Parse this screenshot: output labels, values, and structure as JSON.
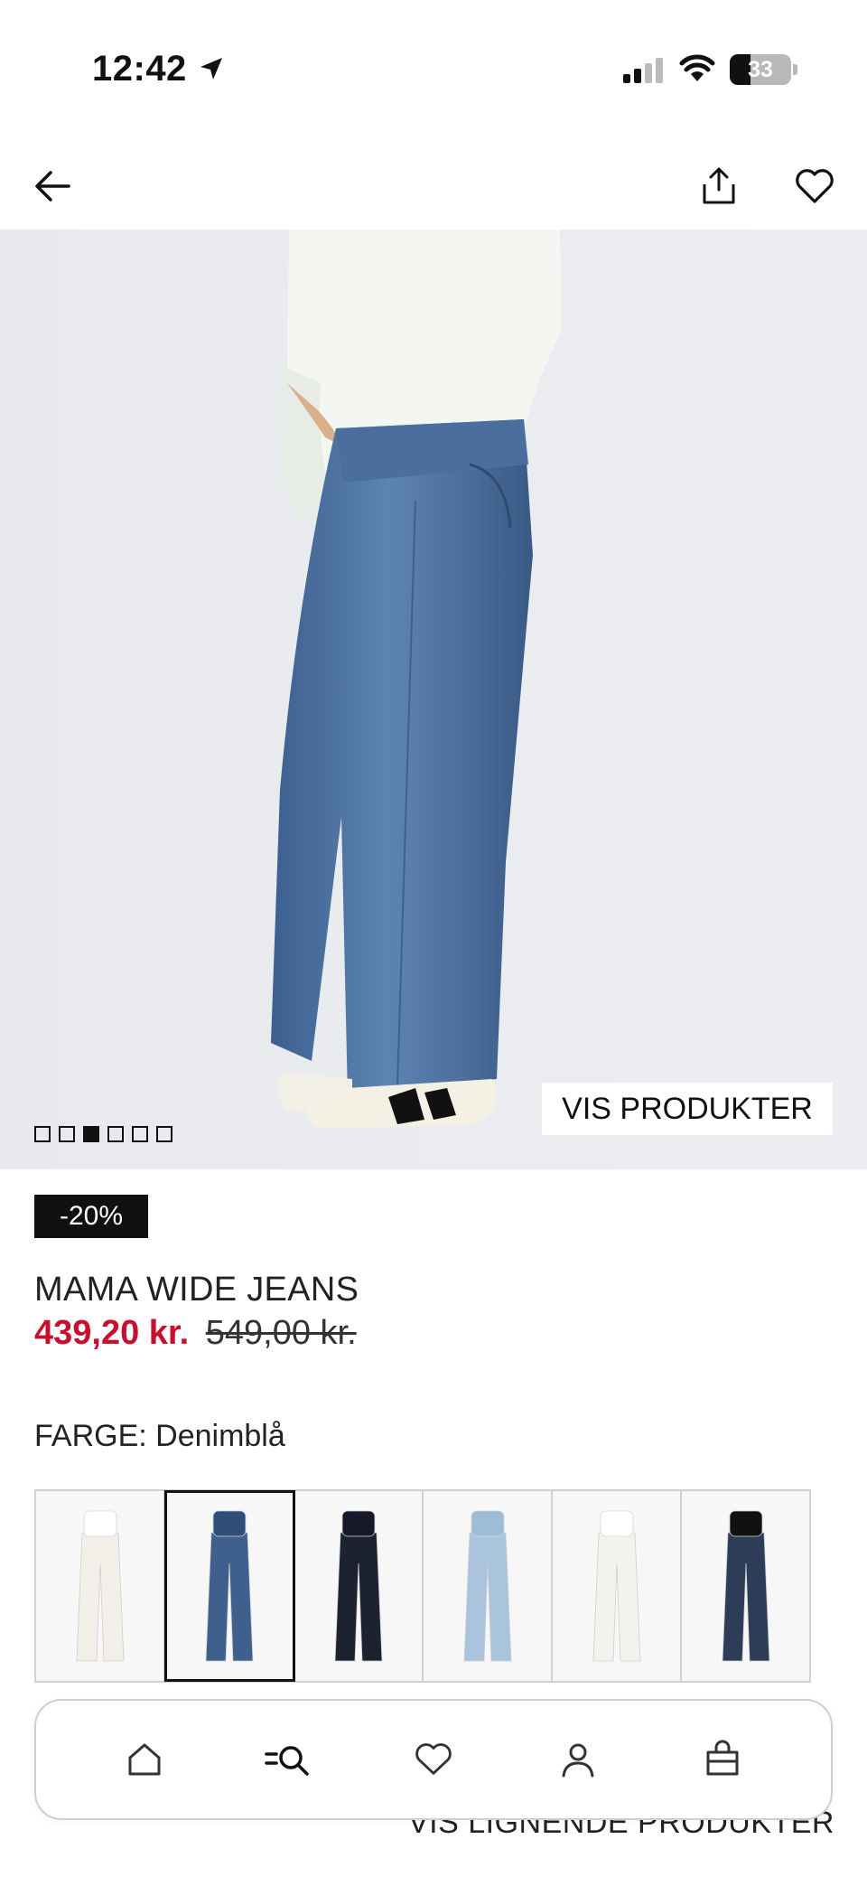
{
  "status_bar": {
    "time": "12:42",
    "battery": "33",
    "icons": [
      "location-arrow-icon",
      "signal-icon",
      "wifi-icon",
      "battery-icon"
    ]
  },
  "top_nav": {
    "icons": [
      "back-arrow-icon",
      "share-icon",
      "heart-icon"
    ]
  },
  "gallery": {
    "image_count": 6,
    "active_index": 2,
    "show_products_label": "VIS PRODUKTER"
  },
  "product": {
    "discount_badge": "-20%",
    "title": "MAMA WIDE JEANS",
    "price_sale": "439,20 kr.",
    "price_original": "549,00 kr."
  },
  "colors": {
    "label": "FARGE: Denimblå",
    "swatches": [
      {
        "tone": "#f1efe8",
        "waist": "#ffffff"
      },
      {
        "tone": "#3f5f8c",
        "waist": "#2f4e7a"
      },
      {
        "tone": "#1c2230",
        "waist": "#15192a"
      },
      {
        "tone": "#a9c4dc",
        "waist": "#9dbcd6"
      },
      {
        "tone": "#f4f2ec",
        "waist": "#ffffff"
      },
      {
        "tone": "#2d3d58",
        "waist": "#111111"
      }
    ],
    "selected_index": 1
  },
  "similar_products_label": "VIS LIGNENDE PRODUKTER",
  "tab_bar": {
    "icons": [
      "home-icon",
      "search-menu-icon",
      "heart-icon",
      "account-icon",
      "bag-icon"
    ]
  },
  "accent_color": "#c8102e"
}
